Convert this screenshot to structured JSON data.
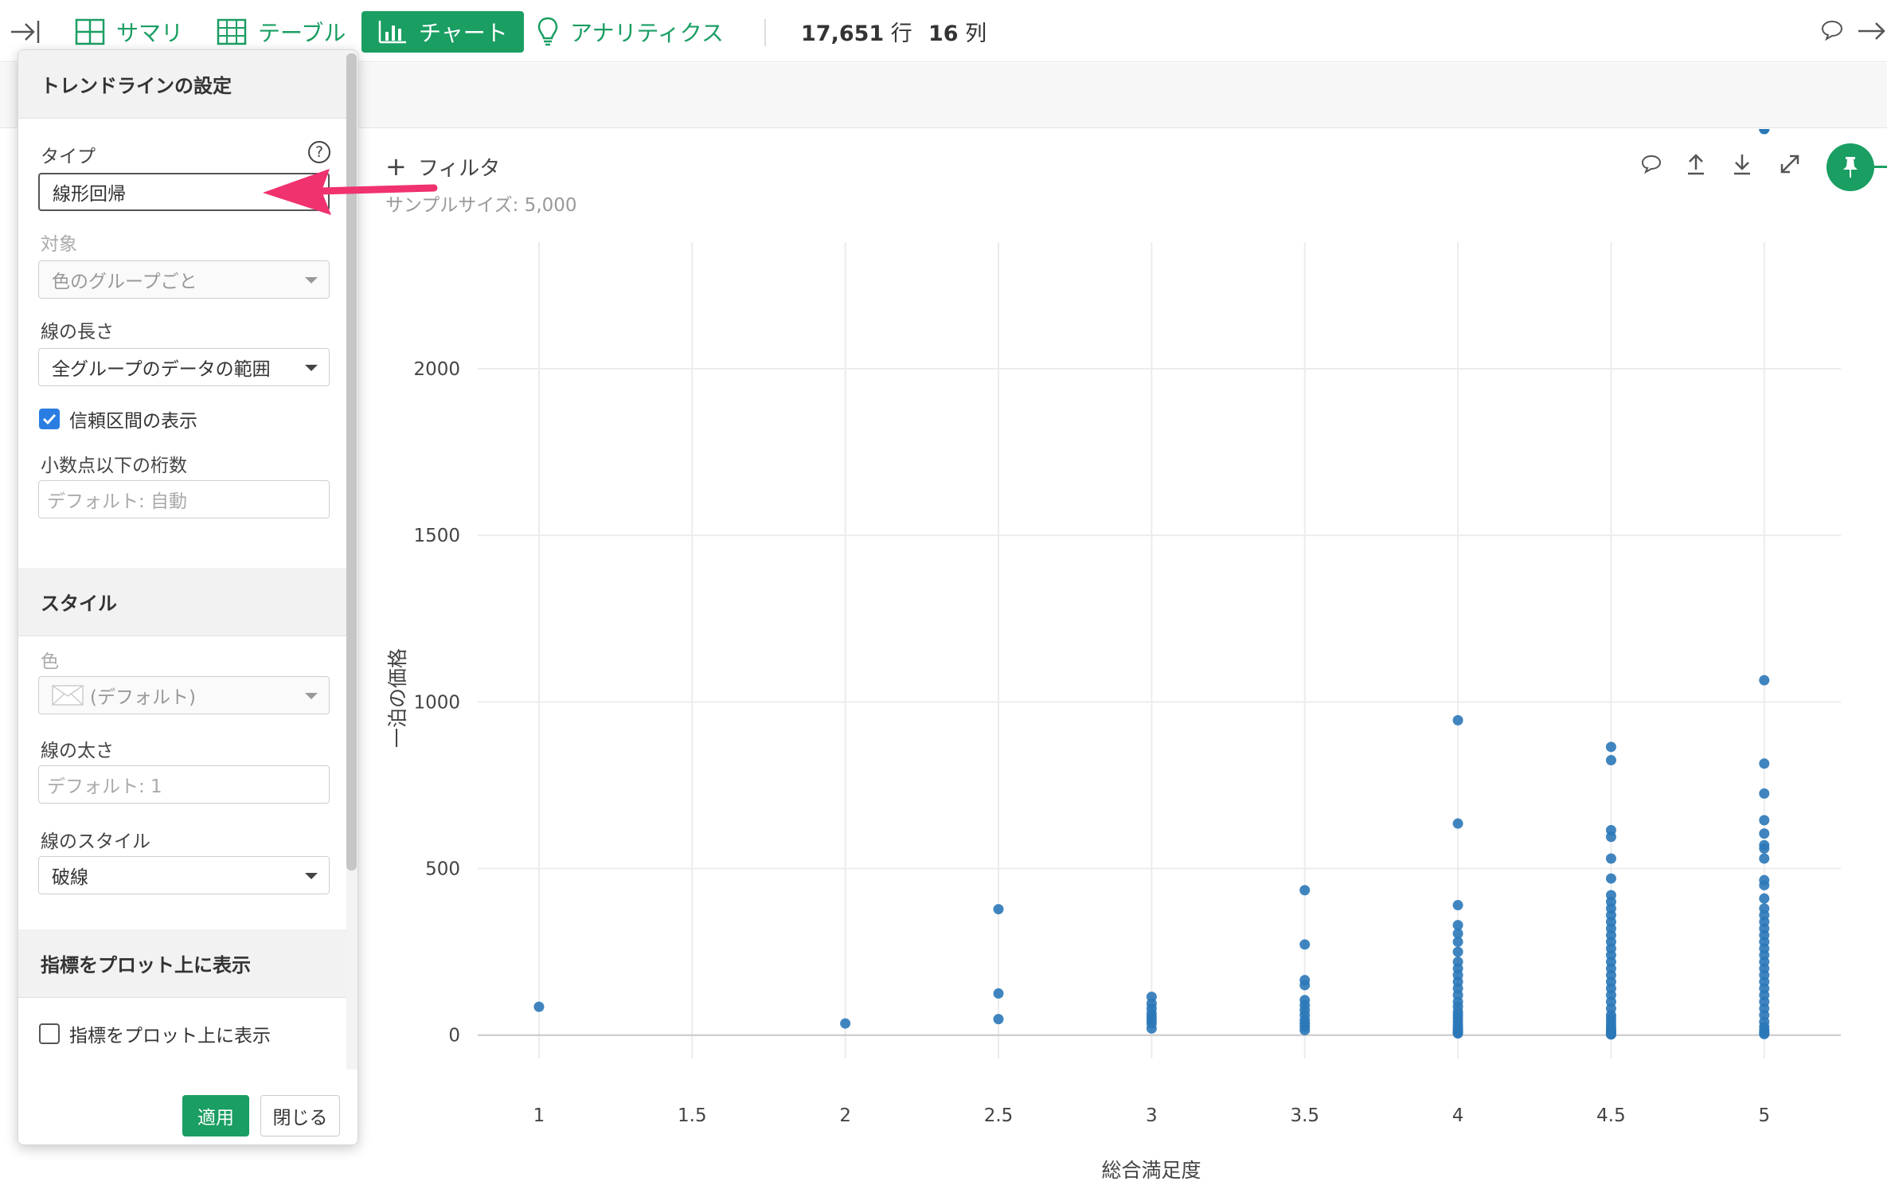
{
  "topbar": {
    "summary": "サマリ",
    "table": "テーブル",
    "chart": "チャート",
    "analytics": "アナリティクス",
    "rows_value": "17,651",
    "rows_unit": "行",
    "cols_value": "16",
    "cols_unit": "列"
  },
  "chart_header": {
    "filter": "フィルタ",
    "sample_size": "サンプルサイズ: 5,000"
  },
  "panel": {
    "title": "トレンドラインの設定",
    "type_label": "タイプ",
    "type_value": "線形回帰",
    "target_label": "対象",
    "target_value": "色のグループごと",
    "length_label": "線の長さ",
    "length_value": "全グループのデータの範囲",
    "confidence_label": "信頼区間の表示",
    "confidence_checked": true,
    "decimals_label": "小数点以下の桁数",
    "decimals_placeholder": "デフォルト: 自動",
    "style_title": "スタイル",
    "color_label": "色",
    "color_value": "(デフォルト)",
    "width_label": "線の太さ",
    "width_placeholder": "デフォルト: 1",
    "linestyle_label": "線のスタイル",
    "linestyle_value": "破線",
    "metrics_title": "指標をプロット上に表示",
    "metrics_check_label": "指標をプロット上に表示",
    "metrics_checked": false,
    "apply": "適用",
    "close": "閉じる"
  },
  "chart_data": {
    "type": "scatter",
    "xlabel": "総合満足度",
    "ylabel": "一泊の価格",
    "xlim": [
      0.8,
      5.25
    ],
    "ylim": [
      -70,
      2380
    ],
    "xticks": [
      1,
      1.5,
      2,
      2.5,
      3,
      3.5,
      4,
      4.5,
      5
    ],
    "xtick_labels": [
      "1",
      "1.5",
      "2",
      "2.5",
      "3",
      "3.5",
      "4",
      "4.5",
      "5"
    ],
    "yticks": [
      0,
      500,
      1000,
      1500,
      2000
    ],
    "ytick_labels": [
      "0",
      "500",
      "1000",
      "1500",
      "2000"
    ],
    "grid": true,
    "point_color": "#2b78b8",
    "x": [
      1,
      2,
      2.5,
      2.5,
      2.5,
      3,
      3,
      3,
      3,
      3,
      3,
      3,
      3,
      3.5,
      3.5,
      3.5,
      3.5,
      3.5,
      3.5,
      3.5,
      3.5,
      3.5,
      3.5,
      3.5,
      3.5,
      4,
      4,
      4,
      4,
      4,
      4,
      4,
      4,
      4,
      4,
      4,
      4,
      4,
      4,
      4,
      4,
      4,
      4,
      4,
      4,
      4,
      4,
      4,
      4,
      4,
      4,
      4.5,
      4.5,
      4.5,
      4.5,
      4.5,
      4.5,
      4.5,
      4.5,
      4.5,
      4.5,
      4.5,
      4.5,
      4.5,
      4.5,
      4.5,
      4.5,
      4.5,
      4.5,
      4.5,
      4.5,
      4.5,
      4.5,
      4.5,
      4.5,
      4.5,
      4.5,
      4.5,
      4.5,
      4.5,
      4.5,
      4.5,
      4.5,
      4.5,
      4.5,
      4.5,
      4.5,
      5,
      5,
      5,
      5,
      5,
      5,
      5,
      5,
      5,
      5,
      5,
      5,
      5,
      5,
      5,
      5,
      5,
      5,
      5,
      5,
      5,
      5,
      5,
      5,
      5,
      5,
      5,
      5,
      5,
      5,
      5,
      5,
      5,
      5,
      5,
      5,
      5,
      5
    ],
    "y": [
      85,
      35,
      378,
      125,
      48,
      115,
      95,
      80,
      65,
      55,
      45,
      35,
      20,
      435,
      272,
      165,
      150,
      105,
      90,
      75,
      60,
      45,
      35,
      25,
      15,
      945,
      635,
      390,
      330,
      305,
      280,
      250,
      220,
      200,
      180,
      160,
      140,
      120,
      100,
      85,
      70,
      60,
      50,
      40,
      30,
      22,
      18,
      14,
      10,
      8,
      5,
      865,
      825,
      615,
      595,
      530,
      470,
      420,
      400,
      380,
      360,
      340,
      320,
      300,
      280,
      260,
      240,
      220,
      200,
      180,
      160,
      140,
      120,
      100,
      80,
      60,
      50,
      40,
      30,
      20,
      15,
      10,
      8,
      5,
      4,
      3,
      2,
      1065,
      815,
      725,
      645,
      605,
      570,
      560,
      530,
      465,
      450,
      410,
      380,
      360,
      340,
      320,
      300,
      280,
      260,
      240,
      220,
      200,
      180,
      160,
      140,
      120,
      100,
      80,
      60,
      40,
      25,
      15,
      10,
      6,
      3
    ]
  }
}
